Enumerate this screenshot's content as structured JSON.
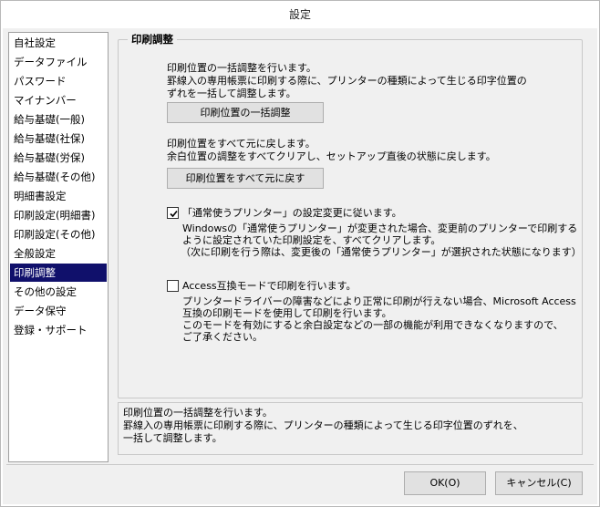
{
  "window": {
    "title": "設定"
  },
  "sidebar": {
    "items": [
      {
        "label": "自社設定"
      },
      {
        "label": "データファイル"
      },
      {
        "label": "パスワード"
      },
      {
        "label": "マイナンバー"
      },
      {
        "label": "給与基礎(一般)"
      },
      {
        "label": "給与基礎(社保)"
      },
      {
        "label": "給与基礎(労保)"
      },
      {
        "label": "給与基礎(その他)"
      },
      {
        "label": "明細書設定"
      },
      {
        "label": "印刷設定(明細書)"
      },
      {
        "label": "印刷設定(その他)"
      },
      {
        "label": "全般設定"
      },
      {
        "label": "印刷調整"
      },
      {
        "label": "その他の設定"
      },
      {
        "label": "データ保守"
      },
      {
        "label": "登録・サポート"
      }
    ],
    "selected": "印刷調整"
  },
  "panel": {
    "title": "印刷調整",
    "batch": {
      "line1": "印刷位置の一括調整を行います。",
      "line2": "罫線入の専用帳票に印刷する際に、プリンターの種類によって生じる印字位置の",
      "line3": "ずれを一括して調整します。",
      "button": "印刷位置の一括調整"
    },
    "reset": {
      "line1": "印刷位置をすべて元に戻します。",
      "line2": "余白位置の調整をすべてクリアし、セットアップ直後の状態に戻します。",
      "button": "印刷位置をすべて元に戻す"
    },
    "default_printer": {
      "checked": true,
      "label": "「通常使うプリンター」の設定変更に従います。",
      "line1": "Windowsの「通常使うプリンター」が変更された場合、変更前のプリンターで印刷する",
      "line2": "ように設定されていた印刷設定を、すべてクリアします。",
      "line3": "（次に印刷を行う際は、変更後の「通常使うプリンター」が選択された状態になります）"
    },
    "access_mode": {
      "checked": false,
      "label": "Access互換モードで印刷を行います。",
      "line1": "プリンタードライバーの障害などにより正常に印刷が行えない場合、Microsoft Access",
      "line2": "互換の印刷モードを使用して印刷を行います。",
      "line3": "このモードを有効にすると余白設定などの一部の機能が利用できなくなりますので、",
      "line4": "ご了承ください。"
    }
  },
  "description": {
    "line1": "印刷位置の一括調整を行います。",
    "line2": "罫線入の専用帳票に印刷する際に、プリンターの種類によって生じる印字位置のずれを、",
    "line3": "一括して調整します。"
  },
  "footer": {
    "ok": "OK(O)",
    "cancel": "キャンセル(C)"
  }
}
